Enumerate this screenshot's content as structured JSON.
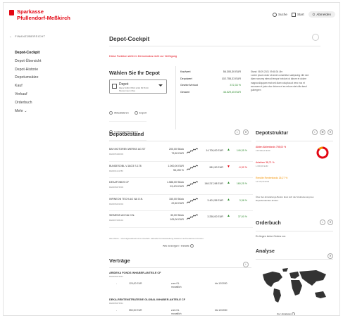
{
  "header": {
    "brand_line1": "Sparkasse",
    "brand_line2": "Pfullendorf-Meßkirch",
    "search_label": "Suche",
    "home_label": "Start",
    "logout_label": "Abmelden"
  },
  "sidebar": {
    "back_label": "FINANZÜBERSICHT",
    "items": [
      {
        "label": "Depot-Cockpit",
        "active": true
      },
      {
        "label": "Depot-Übersicht",
        "active": false
      },
      {
        "label": "Depot-Historie",
        "active": false
      },
      {
        "label": "Depotumsätze",
        "active": false
      },
      {
        "label": "Kauf",
        "active": false
      },
      {
        "label": "Verkauf",
        "active": false
      },
      {
        "label": "Orderbuch",
        "active": false
      },
      {
        "label": "Mehr ⌄",
        "active": false
      }
    ]
  },
  "main": {
    "title": "Depot-Cockpit",
    "warning": "Diese Funktion steht im Demomodus nicht zur Verfügung",
    "choose_depot_title": "Wählen Sie Ihr Depot",
    "depot_select": {
      "name": "Depot",
      "sub": "DE12 3456 7890 1234 5678 00 Mustermann Max"
    },
    "actions": {
      "refresh": "Aktualisieren",
      "export": "Export",
      "configure": "Cockpit konfigurieren"
    },
    "summary": [
      {
        "label": "Kaufwert",
        "value": "56.300,30 EUR",
        "positive": false
      },
      {
        "label": "Depotwert",
        "value": "102.755,33 EUR",
        "positive": false
      },
      {
        "label": "Gewinn/Verlust",
        "value": "372,33 %",
        "positive": true
      },
      {
        "label": "Gesamt",
        "value": "46.529,45 EUR",
        "positive": true
      }
    ],
    "note_title": "Stand: 08.09.2021 09:48:34 Uhr",
    "note_text": "Lorem ipsum dolor sit amet consetetur sadipscing elitr sed diam nonumy eirmod tempor invidunt ut labore et dolore magna aliquyam erat sed diam voluptua at vero eos et accusam et justo duo dolores et ea rebum stet clita kasd gubergren"
  },
  "depotbestand": {
    "title": "Depotbestand",
    "rows": [
      {
        "name": "BAY.MOTOREN WERKE AG ST",
        "isin": "DE0005190003",
        "qty": "200,00 Stück",
        "price": "73,50 EUR",
        "value": "14.700,00 EUR",
        "trend": "up",
        "change": "149,35 %"
      },
      {
        "name": "BUNDESOBL.V.18/23 S.178",
        "isin": "DE0001141786",
        "qty": "1.000,00 EUR",
        "price": "98,190 %",
        "value": "981,90 EUR",
        "trend": "down",
        "change": "-0,32 %"
      },
      {
        "name": "DEKAFONDS CF",
        "isin": "DE0008474503",
        "qty": "1.586,00 Stück",
        "price": "93,476 EUR",
        "value": "148.217,98 EUR",
        "trend": "up",
        "change": "160,25 %"
      },
      {
        "name": "INFINEON TECH.AG NA O.N.",
        "isin": "DE0006231004",
        "qty": "150,00 Stück",
        "price": "22,60 EUR",
        "value": "3.401,55 EUR",
        "trend": "up",
        "change": "3,38 %"
      },
      {
        "name": "SIEMENS AG NA O.N.",
        "isin": "DE0007236101",
        "qty": "30,00 Stück",
        "price": "105,00 EUR",
        "value": "3.250,00 EUR",
        "trend": "up",
        "change": "37,00 %"
      }
    ],
    "footnote": "Alle Werte - sind tagesaktuell ohne Gewähr. Aktuelle Kursdarstellung basieren auf bekannten Kursen.",
    "show_all": "Alle anzeigen / Details"
  },
  "vertraege": {
    "title": "Verträge",
    "items": [
      {
        "name": "ARIDEKA FONDS INHABER-ANTEILE CF",
        "isin": "DE0008474511",
        "dash": "-",
        "amount": "125,00 EUR",
        "freq1": "zum 01.",
        "freq2": "monatlich",
        "until": "bis 12/2030"
      },
      {
        "name": "DEKA-RENTENSTRATEGIE GLOBAL INHABER-ANTEILE CF",
        "isin": "DE0008474511",
        "dash": "-",
        "amount": "550,00 EUR",
        "freq1": "zum 01.",
        "freq2": "monatlich",
        "until": "bis 12/2030"
      }
    ]
  },
  "depotstruktur": {
    "title": "Depotstruktur",
    "allocations": [
      {
        "label": "Aktien Aktienfonds 798,00 %",
        "sub": "135.500,00 EUR",
        "color": "#e30613"
      },
      {
        "label": "Anleihen 38,71 %",
        "sub": "1.000,00 EUR",
        "color": "#e30613"
      },
      {
        "label": "Rendite Rentenfonds 26,27 %",
        "sub": "14.700,00 EUR",
        "color": "#f39200"
      }
    ],
    "note": "Über den Einstellungs-Button lässt sich die Strukturierung des Depotbestandes ändern.",
    "donut": [
      0.8,
      0.08,
      0.12
    ]
  },
  "orderbuch": {
    "title": "Orderbuch",
    "text": "Es liegen keine Orders vor."
  },
  "analyse": {
    "title": "Analyse",
    "link": "Zur Analyse"
  }
}
